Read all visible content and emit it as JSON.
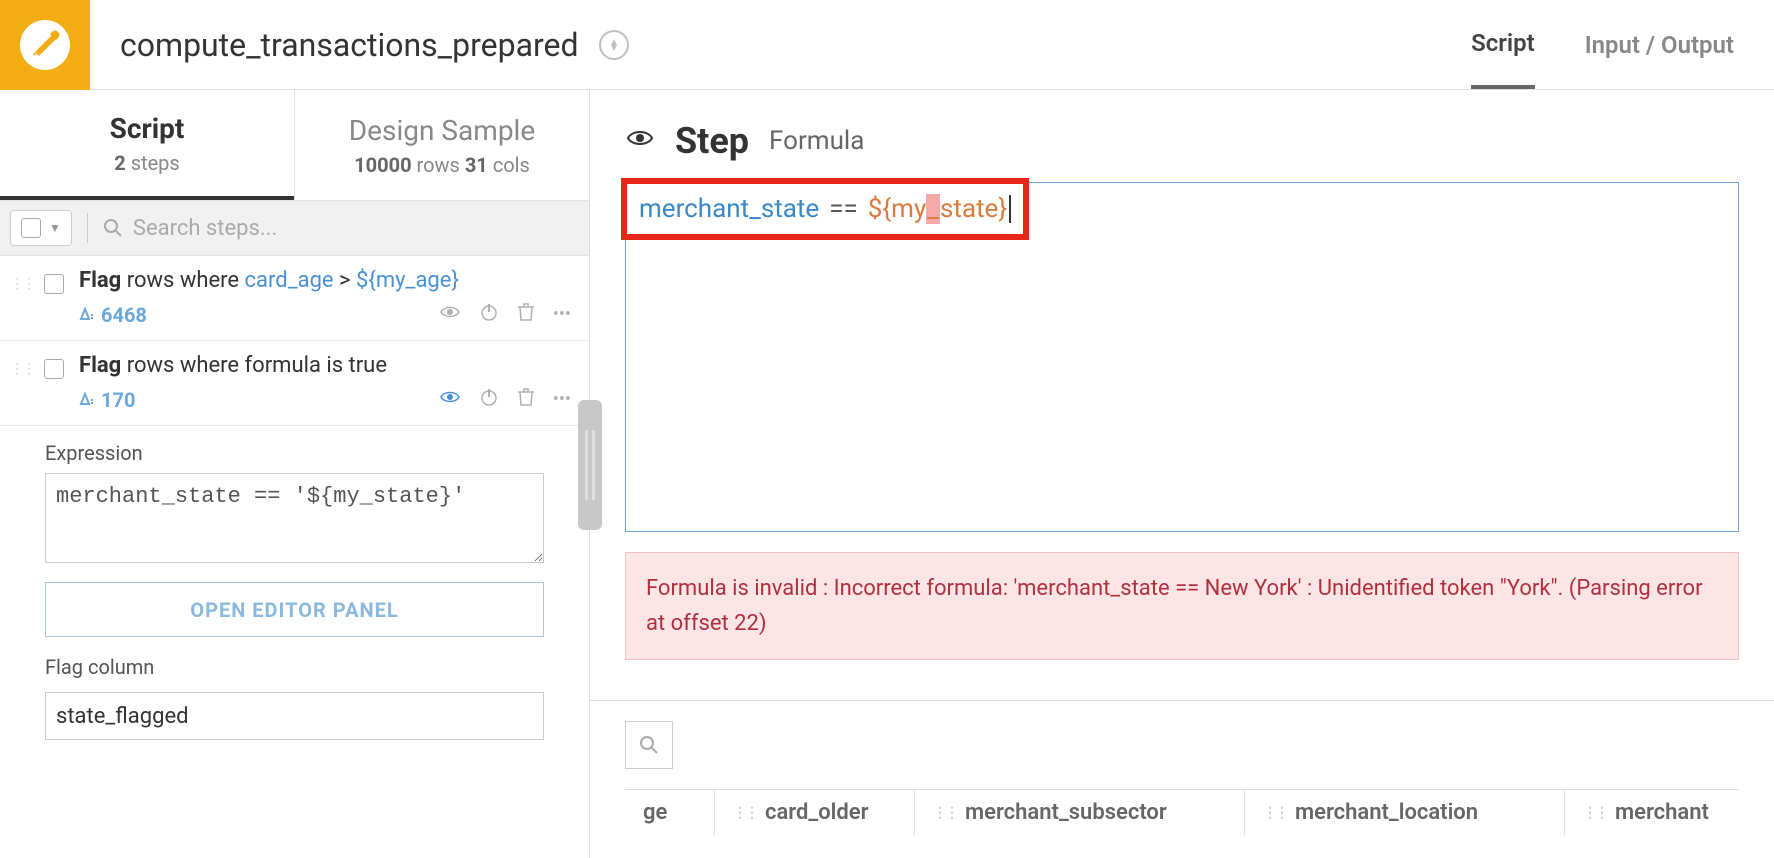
{
  "header": {
    "title": "compute_transactions_prepared",
    "tabs": {
      "script": "Script",
      "input_output": "Input / Output"
    }
  },
  "left": {
    "tabs": {
      "script": {
        "title": "Script",
        "count": "2",
        "count_label": "steps"
      },
      "design": {
        "title": "Design Sample",
        "rows": "10000",
        "rows_label": "rows",
        "cols": "31",
        "cols_label": "cols"
      }
    },
    "search_placeholder": "Search steps...",
    "steps": [
      {
        "prefix": "Flag",
        "text": " rows where ",
        "link1": "card_age",
        "mid": " > ",
        "link2": "${my_age}",
        "count": "6468"
      },
      {
        "prefix": "Flag",
        "text": " rows where formula is true",
        "count": "170"
      }
    ],
    "expression_label": "Expression",
    "expression_value": "merchant_state == '${my_state}'",
    "open_editor": "OPEN EDITOR PANEL",
    "flag_label": "Flag column",
    "flag_value": "state_flagged"
  },
  "right": {
    "step_title": "Step",
    "step_subtitle": "Formula",
    "formula": {
      "col": "merchant_state",
      "op": "==",
      "var_before": "${my",
      "var_hl": "_",
      "var_after": "state}"
    },
    "error": "Formula is invalid : Incorrect formula: 'merchant_state == New York' : Unidentified token \"York\". (Parsing error at offset 22)",
    "columns": [
      "ge",
      "card_older",
      "merchant_subsector",
      "merchant_location",
      "merchant"
    ]
  }
}
